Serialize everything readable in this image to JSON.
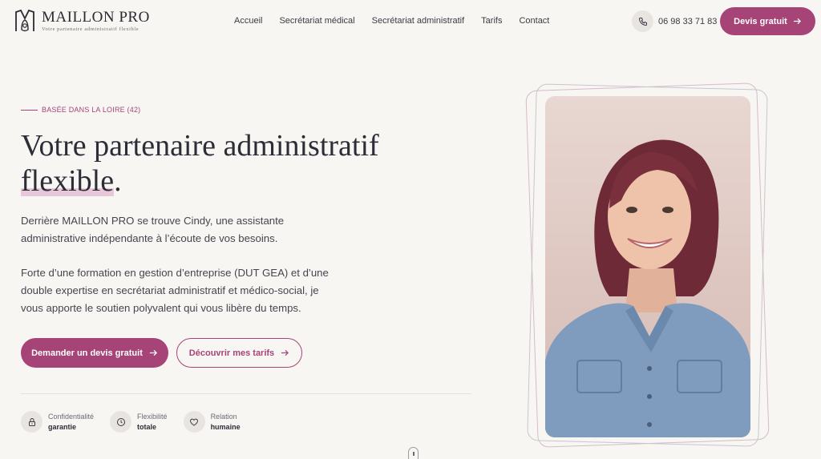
{
  "brand": {
    "name": "MAILLON PRO",
    "tagline": "Votre partenaire administratif flexible"
  },
  "nav": {
    "items": [
      "Accueil",
      "Secrétariat médical",
      "Secrétariat administratif",
      "Tarifs",
      "Contact"
    ]
  },
  "header": {
    "phone": "06 98 33 71 83",
    "phone_icon": "phone-icon",
    "cta_label": "Devis gratuit",
    "cta_icon": "arrow-right-icon"
  },
  "hero": {
    "kicker": "BASÉE DANS LA LOIRE (42)",
    "title_part1": "Votre partenaire administratif",
    "title_highlight": "flexible",
    "title_end": ".",
    "paragraph1": "Derrière MAILLON PRO se trouve Cindy, une assistante administrative indépendante à l’écoute de vos besoins.",
    "paragraph2": "Forte d’une formation en gestion d’entreprise (DUT GEA) et d’une double expertise en secrétariat administratif et médico-social, je vous apporte le soutien polyvalent qui vous libère du temps.",
    "primary_cta": "Demander un devis gratuit",
    "secondary_cta": "Découvrir mes tarifs"
  },
  "features": [
    {
      "icon": "lock-icon",
      "label": "Confidentialité",
      "value": "garantie"
    },
    {
      "icon": "clock-icon",
      "label": "Flexibilité",
      "value": "totale"
    },
    {
      "icon": "heart-icon",
      "label": "Relation",
      "value": "humaine"
    }
  ],
  "colors": {
    "accent": "#a64477",
    "background": "#f8f6f3",
    "text": "#2d2d38",
    "highlight": "#e7c8d8"
  }
}
